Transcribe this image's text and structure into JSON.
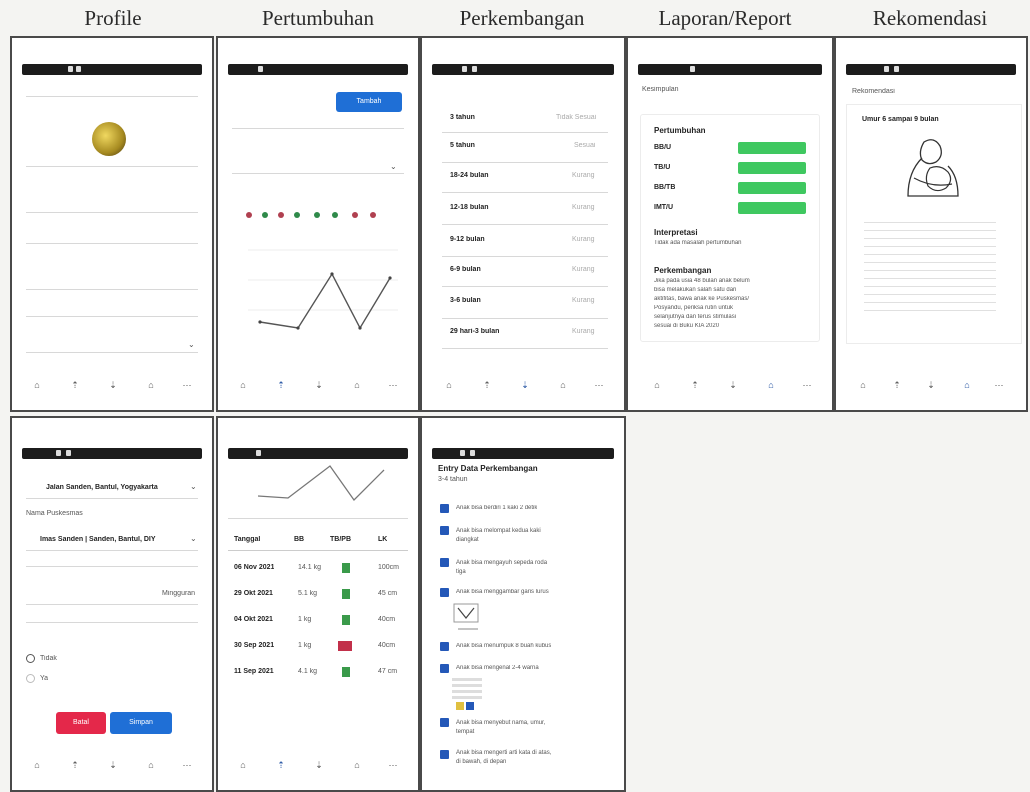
{
  "titles": {
    "profile": "Profile",
    "growth": "Pertumbuhan",
    "development": "Perkembangan",
    "report": "Laporan/Report",
    "recommendation": "Rekomendasi"
  },
  "colors": {
    "green": "#3fc860",
    "blue": "#1f6fd6",
    "red": "#e4284a",
    "checkbox": "#2458b8",
    "status_bar": "#1c1c1c"
  },
  "growth": {
    "button": "Tambah",
    "button2": "Tambah"
  },
  "development": {
    "items": [
      {
        "age": "3 tahun",
        "status": "Tidak Sesuai"
      },
      {
        "age": "5 tahun",
        "status": "Sesuai"
      },
      {
        "age": "18-24 bulan",
        "status": "Kurang"
      },
      {
        "age": "12-18 bulan",
        "status": "Kurang"
      },
      {
        "age": "9-12 bulan",
        "status": "Kurang"
      },
      {
        "age": "6-9 bulan",
        "status": "Kurang"
      },
      {
        "age": "3-6 bulan",
        "status": "Kurang"
      },
      {
        "age": "29 hari-3 bulan",
        "status": "Kurang"
      }
    ]
  },
  "report": {
    "conclusion": "Kesimpulan",
    "growth_title": "Pertumbuhan",
    "metrics": [
      "BB/U",
      "TB/U",
      "BB/TB",
      "IMT/U"
    ],
    "interpretation_title": "Interpretasi",
    "interpretation_text": "Tidak ada masalah pertumbuhan",
    "development_title": "Perkembangan",
    "development_text": [
      "Jika pada usia 48 bulan anak belum",
      "bisa melakukan salah satu dari",
      "aktifitas, bawa anak ke Puskesmas/",
      "Posyandu, periksa rutin untuk",
      "selanjutnya dan terus stimulasi",
      "sesuai di Buku KIA 2020"
    ]
  },
  "recommendation": {
    "header": "Rekomendasi",
    "title": "Umur 6 sampai 9 bulan"
  },
  "profile_form": {
    "address": "Jalan Sanden, Bantul, Yogyakarta",
    "puskesmas_label": "Nama Puskesmas",
    "puskesmas": "Imas Sanden | Sanden, Bantul, DIY",
    "kapanewon_value": "Mingguran",
    "radio_no": "Tidak",
    "radio_yes": "Ya",
    "cancel": "Batal",
    "save": "Simpan"
  },
  "growth_table": {
    "headers": [
      "Tanggal",
      "BB",
      "TB/PB",
      "LK"
    ],
    "rows": [
      {
        "date": "06 Nov 2021",
        "bb": "14.1 kg",
        "lk": "100cm",
        "status": "#3a9a4a"
      },
      {
        "date": "29 Okt 2021",
        "bb": "5.1 kg",
        "lk": "45 cm",
        "status": "#3a9a4a"
      },
      {
        "date": "04 Okt 2021",
        "bb": "1 kg",
        "lk": "40cm",
        "status": "#3a9a4a"
      },
      {
        "date": "30 Sep 2021",
        "bb": "1 kg",
        "lk": "40cm",
        "status": "#c2304a"
      },
      {
        "date": "11 Sep 2021",
        "bb": "4.1 kg",
        "lk": "47 cm",
        "status": "#3a9a4a"
      }
    ]
  },
  "entry": {
    "title": "Entry Data Perkembangan",
    "subtitle": "3-4 tahun",
    "items": [
      "Anak bisa berdiri 1 kaki 2 detik",
      "Anak bisa melompat kedua kaki diangkat",
      "Anak bisa mengayuh sepeda roda tiga",
      "Anak bisa menggambar garis lurus",
      "Anak bisa menumpuk 8 buah kubus",
      "Anak bisa mengenal 2-4 warna",
      "Anak bisa menyebut nama, umur, tempat",
      "Anak bisa mengerti arti kata di atas, di bawah, di depan"
    ]
  }
}
